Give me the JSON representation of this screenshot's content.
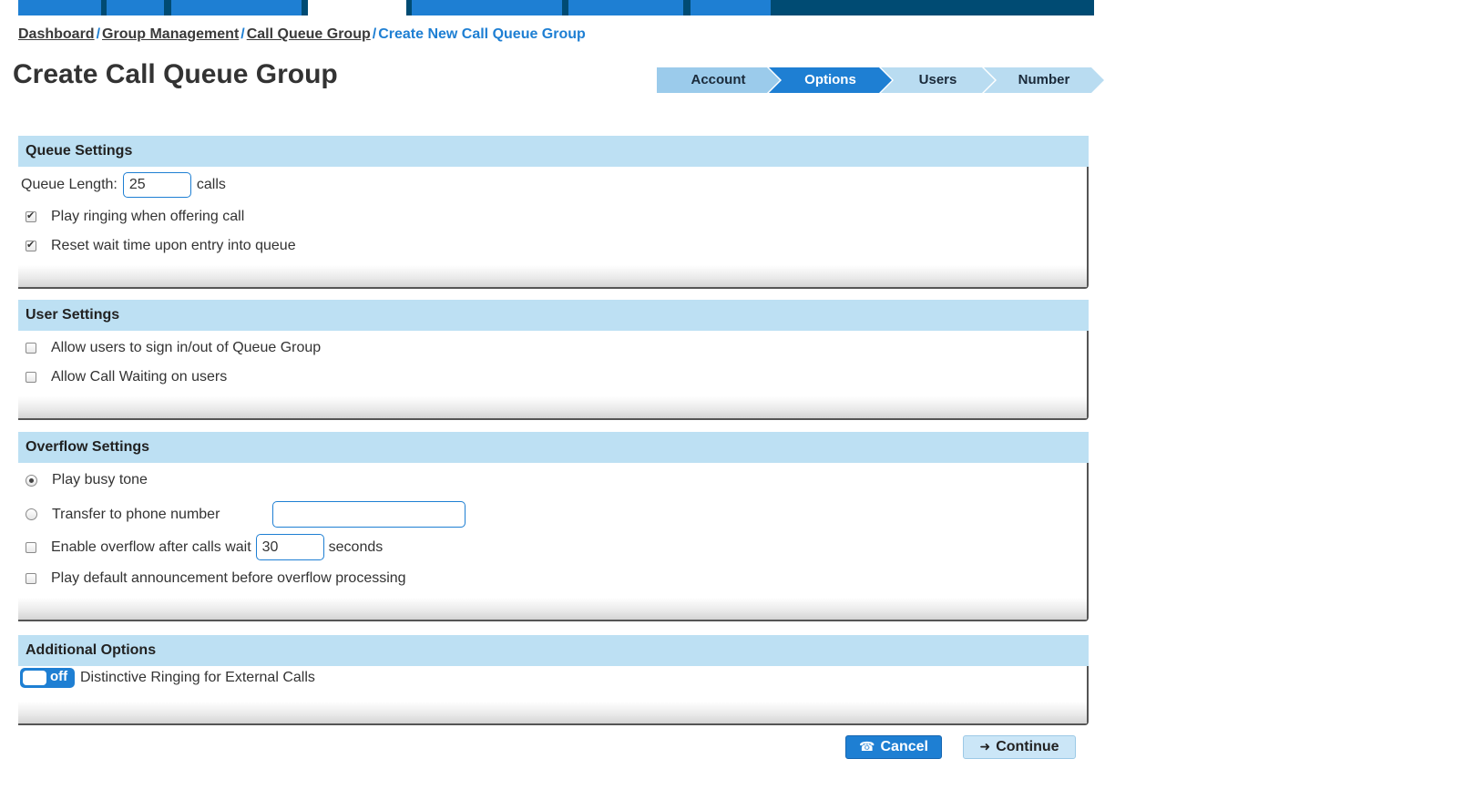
{
  "breadcrumb": {
    "items": [
      {
        "label": "Dashboard"
      },
      {
        "label": "Group Management"
      },
      {
        "label": "Call Queue Group"
      }
    ],
    "current": "Create New Call Queue Group",
    "separator": "/"
  },
  "page": {
    "title": "Create Call Queue Group"
  },
  "steps": [
    {
      "label": "Account",
      "state": "done"
    },
    {
      "label": "Options",
      "state": "active"
    },
    {
      "label": "Users",
      "state": "pending"
    },
    {
      "label": "Number",
      "state": "pending"
    }
  ],
  "queue_settings": {
    "title": "Queue Settings",
    "queue_length_label": "Queue Length:",
    "queue_length_value": "25",
    "queue_length_unit": "calls",
    "play_ringing_label": "Play ringing when offering call",
    "play_ringing_checked": true,
    "reset_wait_label": "Reset wait time upon entry into queue",
    "reset_wait_checked": true
  },
  "user_settings": {
    "title": "User Settings",
    "allow_sign_label": "Allow users to sign in/out of Queue Group",
    "allow_sign_checked": false,
    "allow_call_waiting_label": "Allow Call Waiting on users",
    "allow_call_waiting_checked": false
  },
  "overflow_settings": {
    "title": "Overflow Settings",
    "play_busy_label": "Play busy tone",
    "play_busy_selected": true,
    "transfer_label": "Transfer to phone number",
    "transfer_selected": false,
    "transfer_value": "",
    "enable_overflow_label": "Enable overflow after calls wait",
    "enable_overflow_checked": false,
    "enable_overflow_value": "30",
    "enable_overflow_unit": "seconds",
    "play_announcement_label": "Play default announcement before overflow processing",
    "play_announcement_checked": false
  },
  "additional_options": {
    "title": "Additional Options",
    "toggle_state": "off",
    "distinctive_ringing_label": "Distinctive Ringing for External Calls"
  },
  "actions": {
    "cancel_label": "Cancel",
    "cancel_icon": "phone-hangup-icon",
    "continue_label": "Continue",
    "continue_icon": "arrow-right-icon"
  },
  "colors": {
    "accent": "#1e7fd3",
    "nav_dark": "#004b73",
    "panel_header": "#bde0f3",
    "step_inactive": "#b9dcf1"
  }
}
